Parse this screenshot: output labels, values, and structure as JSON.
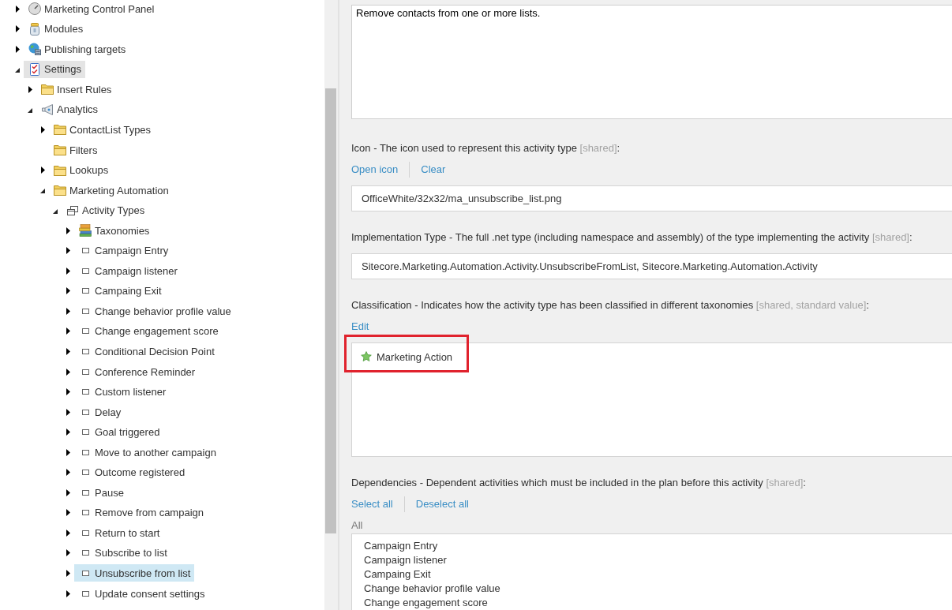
{
  "tree": {
    "items": [
      {
        "label": "Marketing Control Panel",
        "kind": "panel",
        "expanded": false,
        "selected": false,
        "hovered": false
      },
      {
        "label": "Modules",
        "kind": "jar",
        "expanded": false,
        "selected": false,
        "hovered": false
      },
      {
        "label": "Publishing targets",
        "kind": "globe",
        "expanded": false,
        "selected": false,
        "hovered": false
      },
      {
        "label": "Settings",
        "kind": "checklist",
        "expanded": true,
        "selected": false,
        "hovered": true,
        "children": [
          {
            "label": "Insert Rules",
            "kind": "folder",
            "expanded": false,
            "selected": false,
            "hovered": false
          },
          {
            "label": "Analytics",
            "kind": "megaphone",
            "expanded": true,
            "selected": false,
            "hovered": false,
            "children": [
              {
                "label": "ContactList Types",
                "kind": "folder",
                "expanded": false,
                "selected": false,
                "hovered": false
              },
              {
                "label": "Filters",
                "kind": "folder",
                "selected": false,
                "hovered": false
              },
              {
                "label": "Lookups",
                "kind": "folder",
                "expanded": false,
                "selected": false,
                "hovered": false
              },
              {
                "label": "Marketing Automation",
                "kind": "folder",
                "expanded": true,
                "selected": false,
                "hovered": false,
                "children": [
                  {
                    "label": "Activity Types",
                    "kind": "template",
                    "expanded": true,
                    "selected": false,
                    "hovered": false,
                    "children": [
                      {
                        "label": "Taxonomies",
                        "kind": "books",
                        "expanded": false,
                        "selected": false,
                        "hovered": false
                      },
                      {
                        "label": "Campaign Entry",
                        "kind": "item",
                        "expanded": false,
                        "selected": false,
                        "hovered": false
                      },
                      {
                        "label": "Campaign listener",
                        "kind": "item",
                        "expanded": false,
                        "selected": false,
                        "hovered": false
                      },
                      {
                        "label": "Campaing Exit",
                        "kind": "item",
                        "expanded": false,
                        "selected": false,
                        "hovered": false
                      },
                      {
                        "label": "Change behavior profile value",
                        "kind": "item",
                        "expanded": false,
                        "selected": false,
                        "hovered": false
                      },
                      {
                        "label": "Change engagement score",
                        "kind": "item",
                        "expanded": false,
                        "selected": false,
                        "hovered": false
                      },
                      {
                        "label": "Conditional Decision Point",
                        "kind": "item",
                        "expanded": false,
                        "selected": false,
                        "hovered": false
                      },
                      {
                        "label": "Conference Reminder",
                        "kind": "item",
                        "expanded": false,
                        "selected": false,
                        "hovered": false
                      },
                      {
                        "label": "Custom listener",
                        "kind": "item",
                        "expanded": false,
                        "selected": false,
                        "hovered": false
                      },
                      {
                        "label": "Delay",
                        "kind": "item",
                        "expanded": false,
                        "selected": false,
                        "hovered": false
                      },
                      {
                        "label": "Goal triggered",
                        "kind": "item",
                        "expanded": false,
                        "selected": false,
                        "hovered": false
                      },
                      {
                        "label": "Move to another campaign",
                        "kind": "item",
                        "expanded": false,
                        "selected": false,
                        "hovered": false
                      },
                      {
                        "label": "Outcome registered",
                        "kind": "item",
                        "expanded": false,
                        "selected": false,
                        "hovered": false
                      },
                      {
                        "label": "Pause",
                        "kind": "item",
                        "expanded": false,
                        "selected": false,
                        "hovered": false
                      },
                      {
                        "label": "Remove from campaign",
                        "kind": "item",
                        "expanded": false,
                        "selected": false,
                        "hovered": false
                      },
                      {
                        "label": "Return to start",
                        "kind": "item",
                        "expanded": false,
                        "selected": false,
                        "hovered": false
                      },
                      {
                        "label": "Subscribe to list",
                        "kind": "item",
                        "expanded": false,
                        "selected": false,
                        "hovered": false
                      },
                      {
                        "label": "Unsubscribe from list",
                        "kind": "item",
                        "expanded": false,
                        "selected": true,
                        "hovered": false
                      },
                      {
                        "label": "Update consent settings",
                        "kind": "item",
                        "expanded": false,
                        "selected": false,
                        "hovered": false
                      }
                    ]
                  }
                ]
              }
            ]
          }
        ]
      }
    ]
  },
  "fields": [
    {
      "kind": "textarea",
      "value": "Remove contacts from one or more lists."
    },
    {
      "kind": "text",
      "label": "Icon - The icon used to represent this activity type",
      "note": "[shared]",
      "suffix": ":",
      "actions": [
        "Open icon",
        "Clear"
      ],
      "value": "OfficeWhite/32x32/ma_unsubscribe_list.png"
    },
    {
      "kind": "text",
      "label": "Implementation Type - The full .net type (including namespace and assembly) of the type implementing the activity",
      "note": "[shared]",
      "suffix": ":",
      "value": "Sitecore.Marketing.Automation.Activity.UnsubscribeFromList, Sitecore.Marketing.Automation.Activity"
    },
    {
      "kind": "taxonomy",
      "label": "Classification - Indicates how the activity type has been classified in different taxonomies",
      "note": "[shared, standard value]",
      "suffix": ":",
      "actions": [
        "Edit"
      ],
      "items": [
        {
          "label": "Marketing Action",
          "highlighted": true
        }
      ]
    },
    {
      "kind": "checklist",
      "label": "Dependencies - Dependent activities which must be included in the plan before this activity",
      "note": "[shared]",
      "suffix": ":",
      "actions": [
        "Select all",
        "Deselect all"
      ],
      "group": "All",
      "items": [
        {
          "label": "Campaign Entry",
          "selected": false
        },
        {
          "label": "Campaign listener",
          "selected": false
        },
        {
          "label": "Campaing Exit",
          "selected": false
        },
        {
          "label": "Change behavior profile value",
          "selected": false
        },
        {
          "label": "Change engagement score",
          "selected": false
        }
      ]
    }
  ]
}
